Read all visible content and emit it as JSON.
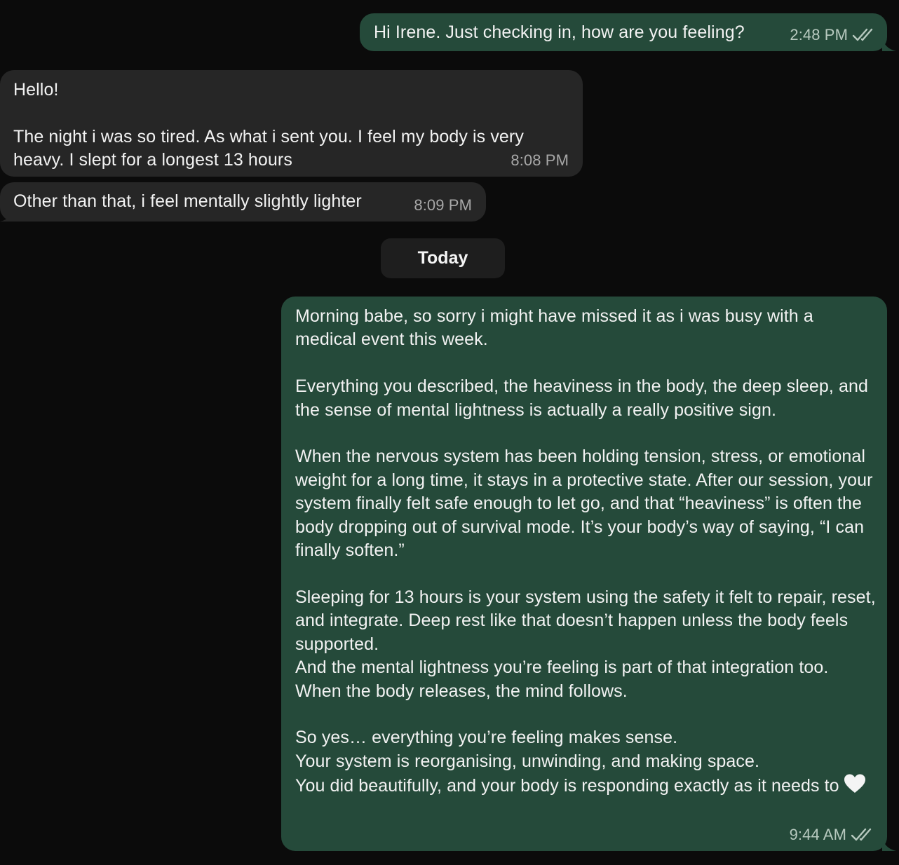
{
  "messages": [
    {
      "direction": "outgoing",
      "text": "Hi Irene. Just checking in, how are you feeling?",
      "time": "2:48 PM",
      "status": "read-double-check-icon"
    },
    {
      "direction": "incoming",
      "text": "Hello!\n\nThe night i was so tired. As what i sent you. I feel my body is very heavy. I slept for a longest 13 hours",
      "time": "8:08 PM"
    },
    {
      "direction": "incoming",
      "text": "Other than that, i feel mentally slightly lighter",
      "time": "8:09 PM"
    },
    {
      "direction": "outgoing",
      "text": "Morning babe, so sorry i might have missed it as i was busy with a medical event this week.\n\nEverything you described, the heaviness in the body, the deep sleep, and the sense of mental lightness is actually a really positive sign.\n\nWhen the nervous system has been holding tension, stress, or emotional weight for a long time, it stays in a protective state. After our session, your system finally felt safe enough to let go, and that “heaviness” is often the body dropping out of survival mode. It’s your body’s way of saying, “I can finally soften.”\n\nSleeping for 13 hours is your system using the safety it felt to repair, reset, and integrate. Deep rest like that doesn’t happen unless the body feels supported.\nAnd the mental lightness you’re feeling is part of that integration too. When the body releases, the mind follows.\n\nSo yes… everything you’re feeling makes sense.\nYour system is reorganising, unwinding, and making space.\nYou did beautifully, and your body is responding exactly as it needs to",
      "emoji": "white-heart-icon",
      "time": "9:44 AM",
      "status": "read-double-check-icon"
    }
  ],
  "date_separator": "Today",
  "colors": {
    "background": "#0b0b0b",
    "outgoing_bubble": "#254a3a",
    "incoming_bubble": "#262626",
    "date_chip": "#1e1e1e",
    "text": "#f2f2f2"
  }
}
